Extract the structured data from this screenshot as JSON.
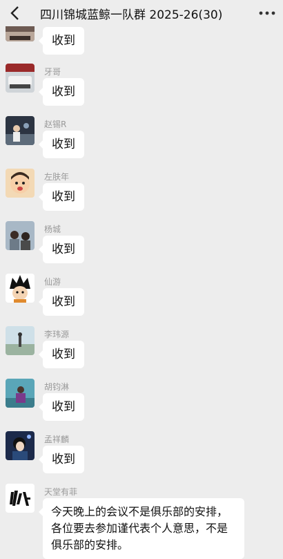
{
  "header": {
    "title": "四川锦城蓝鲸一队群 2025-26(30)",
    "back_icon": "chevron-left-icon",
    "more_icon": "more-dots-icon"
  },
  "messages": [
    {
      "sender": "",
      "text": "收到"
    },
    {
      "sender": "牙哥",
      "text": "收到"
    },
    {
      "sender": "赵锡R",
      "text": "收到"
    },
    {
      "sender": "左肤年",
      "text": "收到"
    },
    {
      "sender": "杨城",
      "text": "收到"
    },
    {
      "sender": "仙游",
      "text": "收到"
    },
    {
      "sender": "李玮源",
      "text": "收到"
    },
    {
      "sender": "胡钧淋",
      "text": "收到"
    },
    {
      "sender": "孟祥麟",
      "text": "收到"
    },
    {
      "sender": "天堂有菲",
      "text": "今天晚上的会议不是俱乐部的安排，各位要去参加谨代表个人意思，不是俱乐部的安排。"
    }
  ]
}
